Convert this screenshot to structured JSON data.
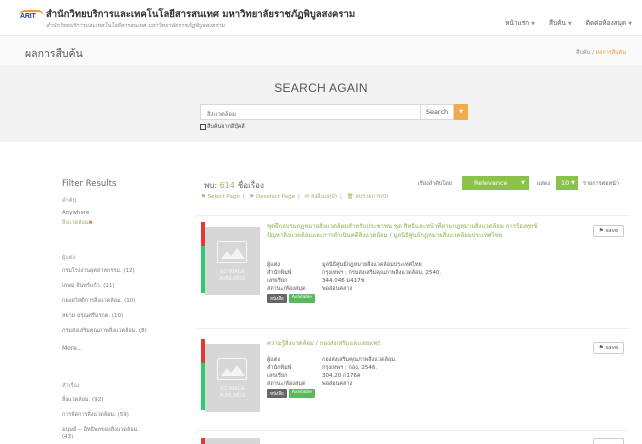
{
  "header": {
    "logo_text": "ARIT",
    "site_title": "สำนักวิทยบริการและเทคโนโลยีสารสนเทศ มหาวิทยาลัยราชภัฏพิบูลสงคราม",
    "site_subtitle": "สำนักวิทยบริการและเทคโนโลยีสารสนเทศ มหาวิทยาลัยราชภัฏพิบูลสงคราม",
    "nav": [
      "หน้าแรก",
      "สืบค้น",
      "ติดต่อห้องสมุด"
    ]
  },
  "titlebar": {
    "title": "ผลการสืบค้น",
    "breadcrumb_home": "สืบค้น",
    "breadcrumb_sep": "/",
    "breadcrumb_current": "ผลการสืบค้น"
  },
  "search": {
    "heading": "SEARCH AGAIN",
    "query": "สิ่งแวดล้อม",
    "button_label": "Search",
    "ebook_label": "สืบค้นจากอีบุ๊คส์"
  },
  "filters": {
    "title": "Filter Results",
    "groups": [
      {
        "head": "คำค้น",
        "items": [
          "Anywhere"
        ],
        "selected": "สิ่งแวดล้อม"
      },
      {
        "head": "ผู้แต่ง",
        "items": [
          "กรมโรงงานอุตสาหกรรม. (12)",
          "เกษม จันทร์แก้ว. (11)",
          "กองสวัสดิการสิ่งแวดล้อม. (10)",
          "สยาม อรุณศรีมรกต. (10)",
          "กรมส่งเสริมคุณภาพสิ่งแวดล้อม. (8)"
        ]
      },
      {
        "head": "หัวเรื่อง",
        "items": [
          "สิ่งแวดล้อม. (92)",
          "การจัดการสิ่งแวดล้อม. (59)",
          "มนุษย์ -- อิทธิพลของสิ่งแวดล้อม.",
          "(43)"
        ]
      }
    ],
    "more_label": "More..."
  },
  "results": {
    "count_prefix": "พบ:",
    "count": "614",
    "count_suffix": "ชื่อเรื่อง",
    "select_page": "Select Page",
    "deselect_page": "Deselect Page",
    "email": "ส่งอีเมล(0)",
    "delete": "ลบรายการ(0)",
    "sort_label": "เรียงลำดับโดย",
    "sort_value": "Relevance",
    "show_label": "แสดง",
    "per_page": "10",
    "per_label": "รายการต่อหน้า",
    "no_image": "NO IMAGE\nAVAILABLE",
    "save_label": "save",
    "items": [
      {
        "title": "ชุดฝึกอบรมกฎหมายสิ่งแวดล้อมสำหรับประชาชน ชุด สิทธิและหน้าที่ตามกฎหมายสิ่งแวดล้อม การร้องทุกข์ปัญหาสิ่งแวดล้อมและการดำเนินคดีสิ่งแวดล้อม / มูลนิธิศูนย์กฎหมายสิ่งแวดล้อมประเทศไทย",
        "meta": [
          [
            "ผู้แต่ง",
            "มูลนิธิศูนย์กฎหมายสิ่งแวดล้อมประเทศไทย"
          ],
          [
            "สำนักพิมพ์",
            "กรุงเทพฯ : กรมส่งเสริมคุณภาพสิ่งแวดล้อม, 2540."
          ],
          [
            "เลขเรียก",
            "344.046 ม417ช"
          ],
          [
            "สถานะ/ห้องสมุด",
            "พอส่อนคลาง"
          ]
        ],
        "tags": [
          "หนังสือ",
          "Available"
        ]
      },
      {
        "title": "ความรู้สิ่งแวดล้อม / กองส่งเสริมและเผยแพร่",
        "meta": [
          [
            "ผู้แต่ง",
            "กองส่งเสริมคุณภาพสิ่งแวดล้อม."
          ],
          [
            "สำนักพิมพ์",
            "กรุงเทพฯ : กอง, 2546."
          ],
          [
            "เลขเรียก",
            "304.20 ก176ค"
          ],
          [
            "สถานะ/ห้องสมุด",
            "พอส่อนคลาง"
          ]
        ],
        "tags": [
          "หนังสือ",
          "Available"
        ]
      }
    ]
  }
}
